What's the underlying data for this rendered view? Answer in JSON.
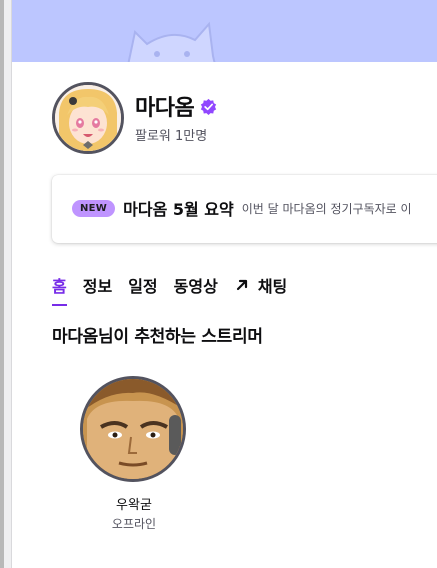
{
  "channel": {
    "name": "마다옴",
    "followers": "팔로워 1만명"
  },
  "notice": {
    "badge": "NEW",
    "title": "마다옴 5월 요약",
    "description": "이번 달 마다옴의 정기구독자로 이"
  },
  "tabs": [
    {
      "label": "홈"
    },
    {
      "label": "정보"
    },
    {
      "label": "일정"
    },
    {
      "label": "동영상"
    },
    {
      "label": "채팅"
    }
  ],
  "recommended": {
    "title": "마다옴님이 추천하는 스트리머",
    "streamers": [
      {
        "name": "우왁굳",
        "status": "오프라인"
      }
    ]
  },
  "colors": {
    "accent": "#772ce8",
    "badge": "#bf94ff",
    "banner": "#bcc6ff"
  }
}
